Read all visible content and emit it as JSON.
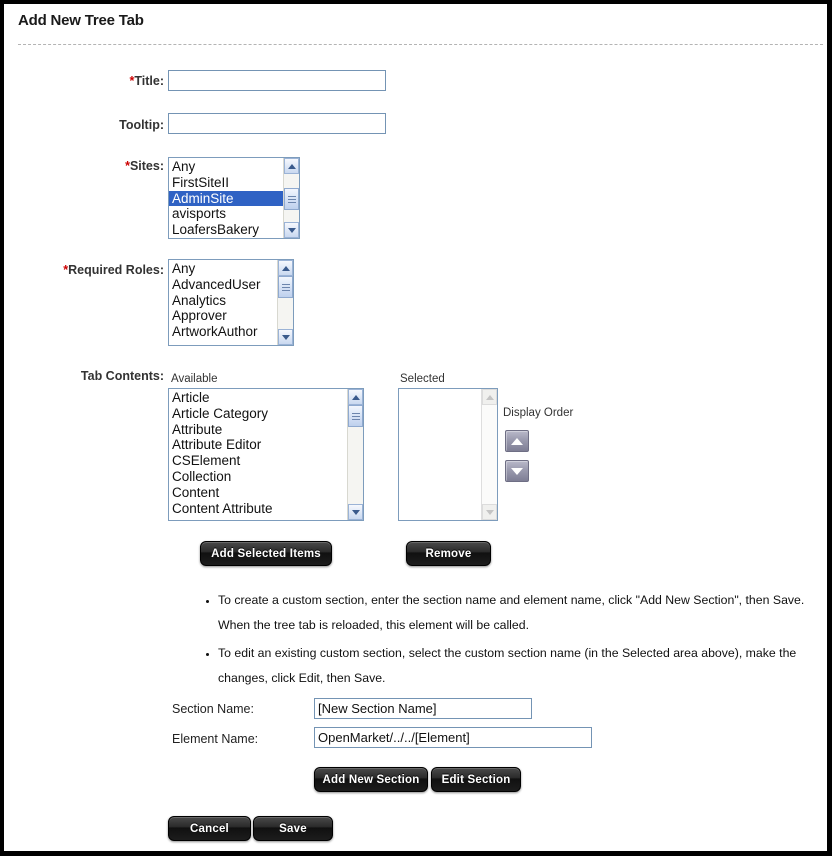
{
  "header": {
    "title": "Add New Tree Tab"
  },
  "fields": {
    "title": {
      "label": "Title:",
      "required": true,
      "value": "",
      "placeholder": ""
    },
    "tooltip": {
      "label": "Tooltip:",
      "required": false,
      "value": "",
      "placeholder": ""
    },
    "sites": {
      "label": "Sites:",
      "required": true,
      "options": [
        "Any",
        "FirstSiteII",
        "AdminSite",
        "avisports",
        "LoafersBakery"
      ],
      "selected": "AdminSite"
    },
    "required_roles": {
      "label": "Required Roles:",
      "required": true,
      "options": [
        "Any",
        "AdvancedUser",
        "Analytics",
        "Approver",
        "ArtworkAuthor"
      ],
      "selected": ""
    },
    "tab_contents": {
      "label": "Tab Contents:",
      "available_caption": "Available",
      "selected_caption": "Selected",
      "display_order_caption": "Display Order",
      "available_options": [
        "Article",
        "Article Category",
        "Attribute",
        "Attribute Editor",
        "CSElement",
        "Collection",
        "Content",
        "Content Attribute"
      ],
      "selected_options": []
    },
    "section_name": {
      "label": "Section Name:",
      "value": "[New Section Name]"
    },
    "element_name": {
      "label": "Element Name:",
      "value": "OpenMarket/../../[Element]"
    }
  },
  "buttons": {
    "add_selected_items": "Add Selected Items",
    "remove": "Remove",
    "move_up_icon": "arrow-up-icon",
    "move_down_icon": "arrow-down-icon",
    "add_new_section": "Add New Section",
    "edit_section": "Edit Section",
    "cancel": "Cancel",
    "save": "Save"
  },
  "notes": [
    "To create a custom section, enter the section name and element name, click \"Add New Section\", then Save. When the tree tab is reloaded, this element will be called.",
    "To edit an existing custom section, select the custom section name (in the Selected area above), make the changes, click Edit, then Save."
  ],
  "colors": {
    "required_asterisk": "#cc0000",
    "selection_blue": "#2f62c4",
    "field_border": "#7494b4",
    "button_black": "#1c1c1c",
    "page_border": "#000000"
  }
}
